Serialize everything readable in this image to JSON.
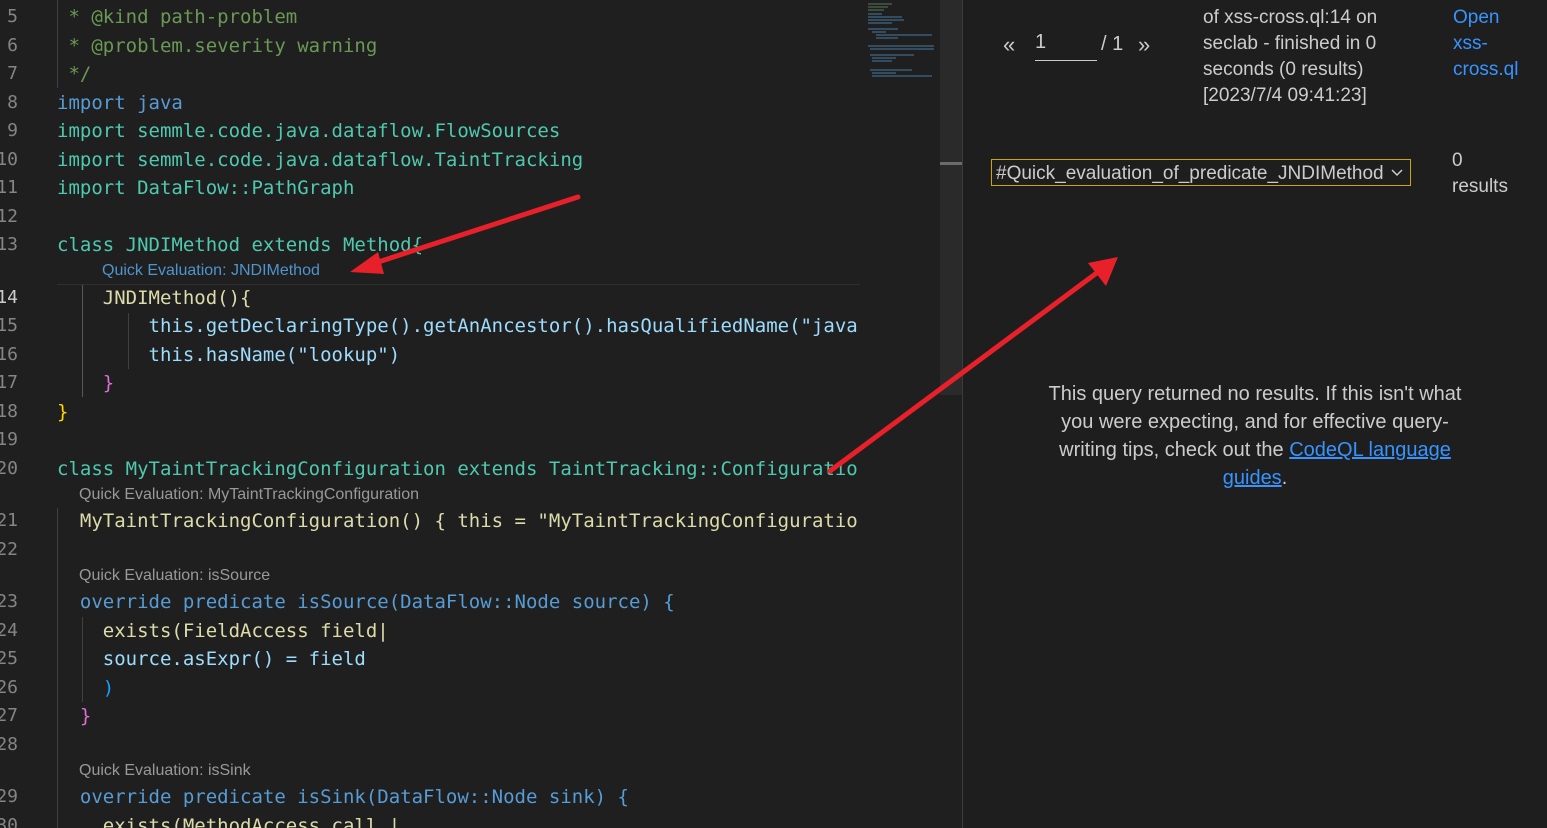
{
  "editor": {
    "lines": [
      {
        "n": "5",
        "text": " * @kind path-problem"
      },
      {
        "n": "6",
        "text": " * @problem.severity warning"
      },
      {
        "n": "7",
        "text": " */"
      },
      {
        "n": "8",
        "text": "import java"
      },
      {
        "n": "9",
        "text": "import semmle.code.java.dataflow.FlowSources"
      },
      {
        "n": "10",
        "text": "import semmle.code.java.dataflow.TaintTracking"
      },
      {
        "n": "11",
        "text": "import DataFlow::PathGraph"
      },
      {
        "n": "12",
        "text": ""
      },
      {
        "n": "13",
        "text": "class JNDIMethod extends Method{"
      },
      {
        "n": "14",
        "text": "    JNDIMethod(){"
      },
      {
        "n": "15",
        "text": "        this.getDeclaringType().getAnAncestor().hasQualifiedName(\"java"
      },
      {
        "n": "16",
        "text": "        this.hasName(\"lookup\")"
      },
      {
        "n": "17",
        "text": "    }"
      },
      {
        "n": "18",
        "text": "}"
      },
      {
        "n": "19",
        "text": ""
      },
      {
        "n": "20",
        "text": "class MyTaintTrackingConfiguration extends TaintTracking::Configuratio"
      },
      {
        "n": "21",
        "text": "  MyTaintTrackingConfiguration() { this = \"MyTaintTrackingConfiguratio"
      },
      {
        "n": "22",
        "text": ""
      },
      {
        "n": "23",
        "text": "  override predicate isSource(DataFlow::Node source) {"
      },
      {
        "n": "24",
        "text": "    exists(FieldAccess field|"
      },
      {
        "n": "25",
        "text": "    source.asExpr() = field"
      },
      {
        "n": "26",
        "text": "    )"
      },
      {
        "n": "27",
        "text": "  }"
      },
      {
        "n": "28",
        "text": ""
      },
      {
        "n": "29",
        "text": "  override predicate isSink(DataFlow::Node sink) {"
      },
      {
        "n": "30",
        "text": "    exists(MethodAccess call |"
      }
    ],
    "code_lens": {
      "jndi": "Quick Evaluation: JNDIMethod",
      "config": "Quick Evaluation: MyTaintTrackingConfiguration",
      "is_source": "Quick Evaluation: isSource",
      "is_sink": "Quick Evaluation: isSink"
    }
  },
  "results_panel": {
    "pager": {
      "prev": "«",
      "current_page": "1",
      "total": "/ 1",
      "next": "»"
    },
    "query_info_lines": [
      "of xss-cross.ql:14 on",
      "seclab - finished in 0",
      "seconds (0 results)",
      "[2023/7/4 09:41:23]"
    ],
    "open_link_lines": [
      "Open",
      "xss-",
      "cross.ql"
    ],
    "result_set": {
      "selected": "#Quick_evaluation_of_predicate_JNDIMethod",
      "chevron_icon": "chevron-down-icon"
    },
    "result_count_lines": [
      "0",
      "results"
    ],
    "no_results": {
      "text": "This query returned no results. If this isn't what you were expecting, and for effective query-writing tips, check out the ",
      "link": "CodeQL language guides",
      "suffix": "."
    }
  },
  "colors": {
    "annotation_arrow": "#e8202a",
    "link": "#3794ff",
    "select_border": "#cca700"
  }
}
